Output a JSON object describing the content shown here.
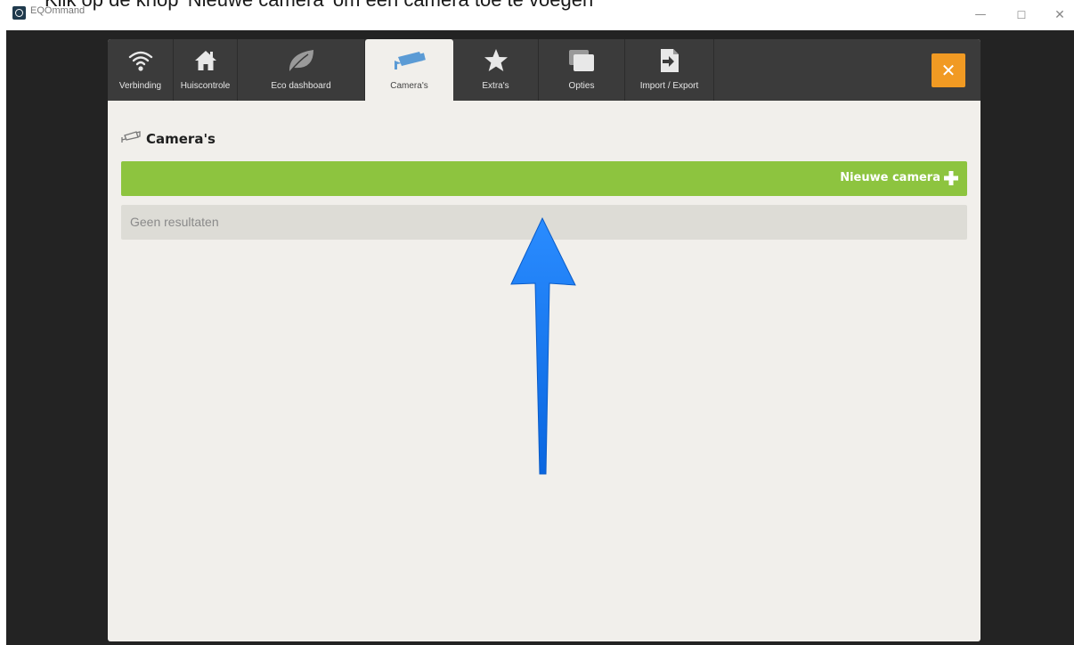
{
  "caption": "Klik op de knop 'Nieuwe camera' om een camera toe te voegen",
  "window": {
    "title": "EQOmmand",
    "controls": {
      "minimize": "—",
      "maximize": "☐",
      "close": "✕"
    }
  },
  "tabs": [
    {
      "label": "Verbinding",
      "icon": "wifi-icon"
    },
    {
      "label": "Huiscontrole",
      "icon": "house-icon"
    },
    {
      "label": "Eco dashboard",
      "icon": "leaf-icon"
    },
    {
      "label": "Camera's",
      "icon": "camera-icon",
      "active": true
    },
    {
      "label": "Extra's",
      "icon": "star-icon"
    },
    {
      "label": "Opties",
      "icon": "windows-icon"
    },
    {
      "label": "Import / Export",
      "icon": "import-export-icon"
    }
  ],
  "close_button": {
    "symbol": "✕",
    "color": "#f19a23"
  },
  "section": {
    "title": "Camera's",
    "icon": "camera-outline-icon"
  },
  "new_camera_button": {
    "label": "Nieuwe camera",
    "icon": "plus-icon",
    "color": "#8dc43f"
  },
  "results": {
    "empty_label": "Geen resultaten"
  },
  "annotation": {
    "icon": "blue-arrow-up-icon",
    "color": "#1a7ff0"
  }
}
